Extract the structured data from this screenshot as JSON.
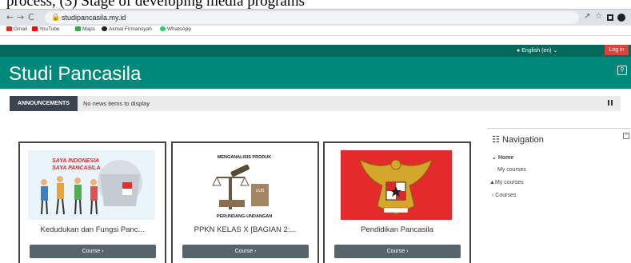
{
  "caption": "process, (3) Stage of developing media programs",
  "browser": {
    "url": "studipancasila.my.id",
    "bookmarks": [
      {
        "label": "Gmail",
        "color": "#d93025"
      },
      {
        "label": "YouTube",
        "color": "#ff0000"
      },
      {
        "label": "Maps",
        "color": "#34a853"
      },
      {
        "label": "Akmal Firmansyah",
        "color": "#202124"
      },
      {
        "label": "WhatsApp",
        "color": "#25d366"
      }
    ],
    "icons": [
      "back-icon",
      "forward-icon",
      "reload-icon",
      "lock-icon",
      "share-icon",
      "star-icon",
      "window-icon",
      "profile-icon"
    ]
  },
  "site": {
    "language": "English (en)",
    "login": "Log in",
    "title": "Studi Pancasila",
    "theme_colors": {
      "topbar": "#00695c",
      "header": "#00897b",
      "login": "#d9453d"
    }
  },
  "announcements": {
    "label": "ANNOUNCEMENTS",
    "text": "No news items to display"
  },
  "courses": [
    {
      "name": "Kedudukan dan Fungsi Panc...",
      "button": "Course ›",
      "image_text": [
        "SAYA INDONESIA",
        "SAYA PANCASILA"
      ]
    },
    {
      "name": "PPKN KELAS X [BAGIAN 2:...",
      "button": "Course ›",
      "image_text": [
        "MENGANALISIS PRODUK",
        "PERUNDANG-UNDANGAN",
        "UUD"
      ]
    },
    {
      "name": "Pendidikan Pancasila",
      "button": "Course ›",
      "image_text": []
    }
  ],
  "navigation": {
    "title": "Navigation",
    "home": "Home",
    "my_courses": "My courses",
    "my_courses_2": "My courses",
    "courses": "Courses"
  }
}
